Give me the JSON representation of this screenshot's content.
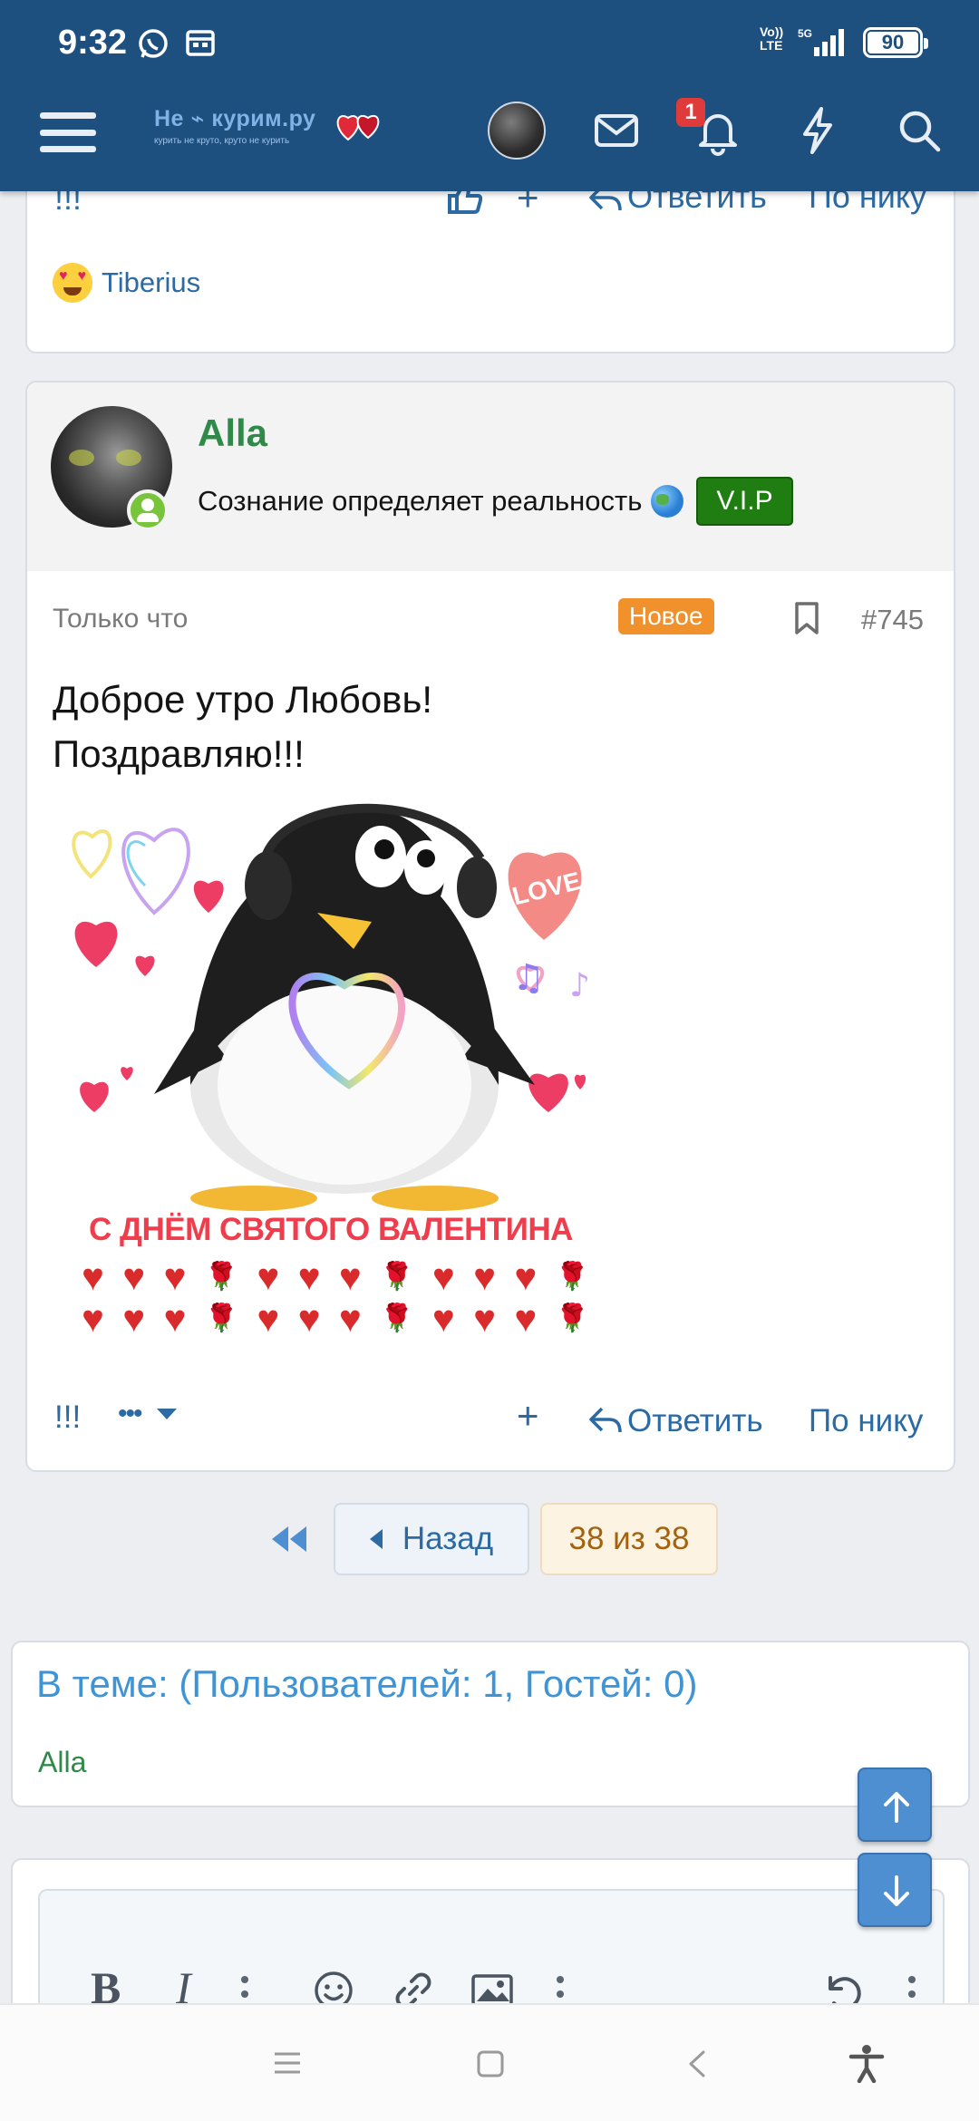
{
  "status": {
    "time": "9:32",
    "network_top": "Vo))",
    "network_bottom": "LTE",
    "net_gen": "5G",
    "battery": "90"
  },
  "header": {
    "logo_title": "Не ⌁ курим.ру",
    "logo_sub": "курить не круто, круто не курить",
    "notif_count": "1"
  },
  "prev_post": {
    "reactor": "Tiberius"
  },
  "post": {
    "username": "Alla",
    "user_title": "Сознание определяет реальность",
    "badge": "V.I.P",
    "time": "Только что",
    "new_label": "Новое",
    "number": "#745",
    "message_line1": "Доброе утро Любовь!",
    "message_line2": "Поздравляю!!!",
    "image_caption": "С ДНЁМ СВЯТОГО ВАЛЕНТИНА",
    "image_text": "LOVE",
    "actions": {
      "report": "!!!",
      "more": "•••",
      "add": "+",
      "reply": "Ответить",
      "by_nick": "По нику"
    }
  },
  "pager": {
    "back": "Назад",
    "current": "38 из 38"
  },
  "in_topic": {
    "title": "В теме: (Пользователей: 1, Гостей: 0)",
    "user": "Alla"
  },
  "colors": {
    "header_bg": "#1d4f7f",
    "link": "#2c6aa3",
    "user_green": "#2f8a4a",
    "vip_green": "#1f7d12",
    "new_orange": "#f0912b",
    "intopic_blue": "#3f94d6"
  }
}
